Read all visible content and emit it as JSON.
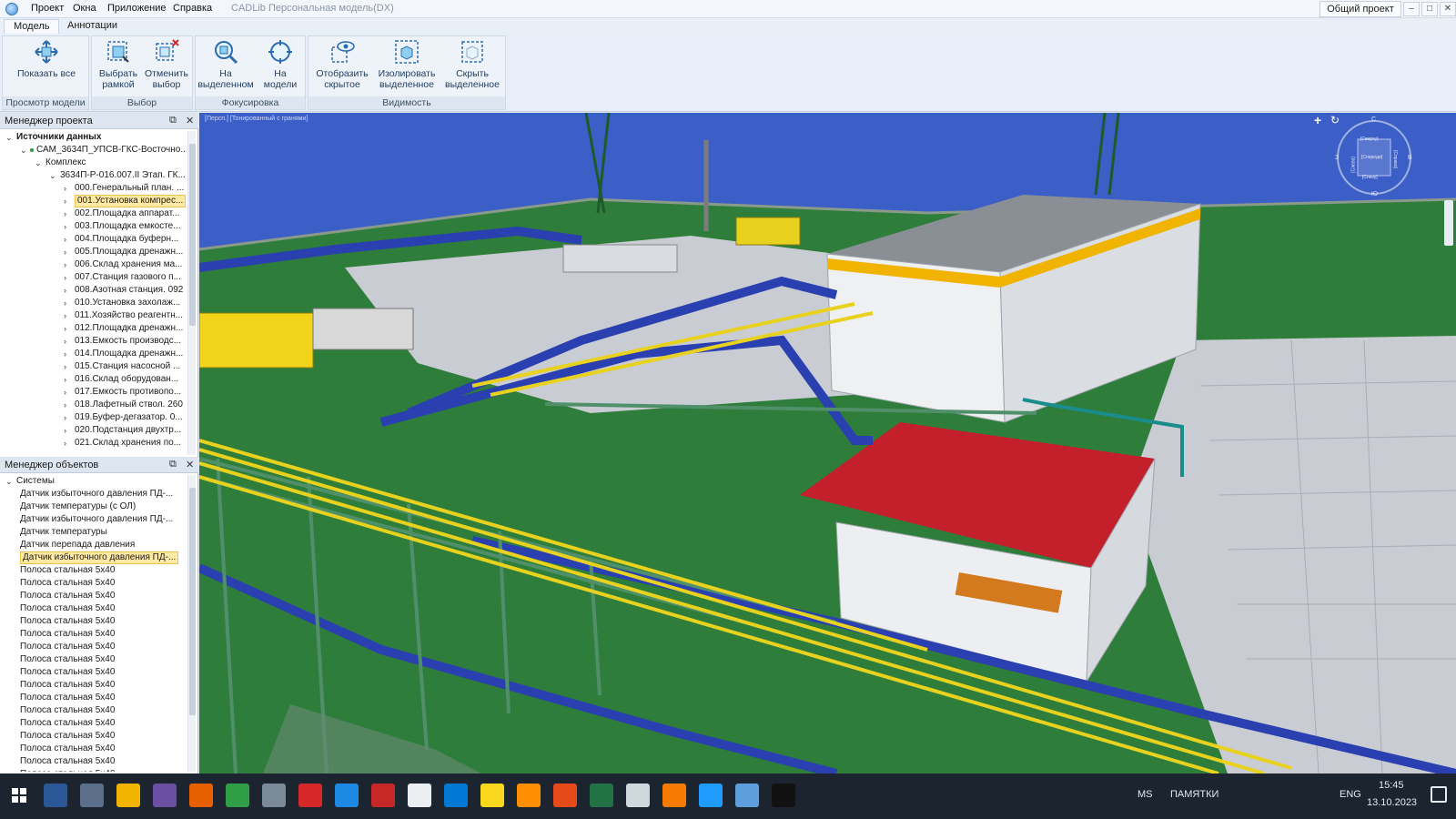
{
  "window": {
    "title": "CADLib Персональная модель(DX)",
    "menu": [
      "Проект",
      "Окна",
      "Приложение",
      "Справка"
    ],
    "shared_project": "Общий проект",
    "controls": [
      "–",
      "□",
      "✕"
    ]
  },
  "ribbon": {
    "tabs": [
      "Модель",
      "Аннотации"
    ],
    "groups": [
      {
        "label": "Просмотр модели",
        "buttons": [
          {
            "label": "Показать все",
            "icon": "show-all-icon"
          }
        ]
      },
      {
        "label": "Выбор",
        "buttons": [
          {
            "label": "Выбрать\nрамкой",
            "icon": "frame-select-icon"
          },
          {
            "label": "Отменить\nвыбор",
            "icon": "cancel-selection-icon"
          }
        ]
      },
      {
        "label": "Фокусировка",
        "buttons": [
          {
            "label": "На\nвыделенном",
            "icon": "zoom-selected-icon"
          },
          {
            "label": "На\nмодели",
            "icon": "zoom-model-icon"
          }
        ]
      },
      {
        "label": "Видимость",
        "buttons": [
          {
            "label": "Отобразить\nскрытое",
            "icon": "show-hidden-icon"
          },
          {
            "label": "Изолировать\nвыделенное",
            "icon": "isolate-icon"
          },
          {
            "label": "Скрыть\nвыделенное",
            "icon": "hide-selected-icon"
          }
        ]
      }
    ]
  },
  "project_manager": {
    "title": "Менеджер проекта",
    "items": [
      {
        "level": 0,
        "text": "Источники данных",
        "expander": "⌄",
        "bold": true
      },
      {
        "level": 1,
        "text": "САМ_3634П_УПСВ-ГКС-Восточно...",
        "expander": "⌄",
        "dot": true
      },
      {
        "level": 2,
        "text": "Комплекс",
        "expander": "⌄"
      },
      {
        "level": 3,
        "text": "3634П-Р-016.007.II Этап. ГК...",
        "expander": "⌄"
      },
      {
        "level": 4,
        "text": "000.Генеральный план. ...",
        "expander": "›"
      },
      {
        "level": 4,
        "text": "001.Установка компрес...",
        "expander": "›",
        "selected": true
      },
      {
        "level": 4,
        "text": "002.Площадка аппарат...",
        "expander": "›"
      },
      {
        "level": 4,
        "text": "003.Площадка емкосте...",
        "expander": "›"
      },
      {
        "level": 4,
        "text": "004.Площадка буферн...",
        "expander": "›"
      },
      {
        "level": 4,
        "text": "005.Площадка дренажн...",
        "expander": "›"
      },
      {
        "level": 4,
        "text": "006.Склад хранения ма...",
        "expander": "›"
      },
      {
        "level": 4,
        "text": "007.Станция газового п...",
        "expander": "›"
      },
      {
        "level": 4,
        "text": "008.Азотная станция. 092",
        "expander": "›"
      },
      {
        "level": 4,
        "text": "010.Установка захолаж...",
        "expander": "›"
      },
      {
        "level": 4,
        "text": "011.Хозяйство реагентн...",
        "expander": "›"
      },
      {
        "level": 4,
        "text": "012.Площадка дренажн...",
        "expander": "›"
      },
      {
        "level": 4,
        "text": "013.Емкость производс...",
        "expander": "›"
      },
      {
        "level": 4,
        "text": "014.Площадка дренажн...",
        "expander": "›"
      },
      {
        "level": 4,
        "text": "015.Станция насосной ...",
        "expander": "›"
      },
      {
        "level": 4,
        "text": "016.Склад оборудован...",
        "expander": "›"
      },
      {
        "level": 4,
        "text": "017.Емкость противопо...",
        "expander": "›"
      },
      {
        "level": 4,
        "text": "018.Лафетный ствол. 260",
        "expander": "›"
      },
      {
        "level": 4,
        "text": "019.Буфер-дегазатор. 0...",
        "expander": "›"
      },
      {
        "level": 4,
        "text": "020.Подстанция двухтр...",
        "expander": "›"
      },
      {
        "level": 4,
        "text": "021.Склад хранения по...",
        "expander": "›"
      }
    ]
  },
  "object_manager": {
    "title": "Менеджер объектов",
    "items": [
      {
        "level": 0,
        "text": "Системы",
        "expander": "⌄"
      },
      {
        "level": 1,
        "text": "Датчик избыточного давления ПД-..."
      },
      {
        "level": 1,
        "text": "Датчик температуры (с ОЛ)"
      },
      {
        "level": 1,
        "text": "Датчик избыточного давления ПД-..."
      },
      {
        "level": 1,
        "text": "Датчик температуры"
      },
      {
        "level": 1,
        "text": "Датчик перепада давления"
      },
      {
        "level": 1,
        "text": "Датчик избыточного давления ПД-...",
        "selected": true
      },
      {
        "level": 1,
        "text": "Полоса стальная 5х40"
      },
      {
        "level": 1,
        "text": "Полоса стальная 5х40"
      },
      {
        "level": 1,
        "text": "Полоса стальная 5х40"
      },
      {
        "level": 1,
        "text": "Полоса стальная 5х40"
      },
      {
        "level": 1,
        "text": "Полоса стальная 5х40"
      },
      {
        "level": 1,
        "text": "Полоса стальная 5х40"
      },
      {
        "level": 1,
        "text": "Полоса стальная 5х40"
      },
      {
        "level": 1,
        "text": "Полоса стальная 5х40"
      },
      {
        "level": 1,
        "text": "Полоса стальная 5х40"
      },
      {
        "level": 1,
        "text": "Полоса стальная 5х40"
      },
      {
        "level": 1,
        "text": "Полоса стальная 5х40"
      },
      {
        "level": 1,
        "text": "Полоса стальная 5х40"
      },
      {
        "level": 1,
        "text": "Полоса стальная 5х40"
      },
      {
        "level": 1,
        "text": "Полоса стальная 5х40"
      },
      {
        "level": 1,
        "text": "Полоса стальная 5х40"
      },
      {
        "level": 1,
        "text": "Полоса стальная 5х40"
      },
      {
        "level": 1,
        "text": "Полоса стальная 5х40"
      },
      {
        "level": 1,
        "text": "Полоса стальная 5х40"
      }
    ]
  },
  "viewport": {
    "caption": "[Персп.] [Тонированный с гранями]",
    "viewcube": {
      "top": "С",
      "bottom": "Ю",
      "left": "З",
      "right": "В",
      "faces": [
        "[Сверху]",
        "[Спереди]",
        "[Слева]",
        "[Справа]",
        "[Снизу]"
      ]
    },
    "colors": {
      "ground": "#2e7d3a",
      "sky": "#3b5fc6",
      "paving": "#c9cdd3",
      "roof_red": "#c4202c",
      "pipe_yellow": "#e8d21f",
      "tray_blue": "#2a3fb0",
      "steel_green": "#4f8f6a"
    }
  },
  "taskbar": {
    "apps": [
      "windows-start-icon",
      "word-icon",
      "save-icon",
      "explorer-icon",
      "outlook-contacts-icon",
      "firefox-icon",
      "project-icon",
      "calculator-icon",
      "acrobat-icon",
      "ie-icon",
      "autocad-icon",
      "notepad-icon",
      "outlook-icon",
      "sticky-icon",
      "paint-icon",
      "eye-icon",
      "excel-icon",
      "file-icon",
      "blender-icon",
      "chat-icon",
      "cadlib-icon",
      "terminal-icon"
    ],
    "tray": {
      "ms": "MS",
      "memo": "ПАМЯТКИ",
      "lang": "ENG",
      "time": "15:45",
      "date": "13.10.2023"
    }
  }
}
